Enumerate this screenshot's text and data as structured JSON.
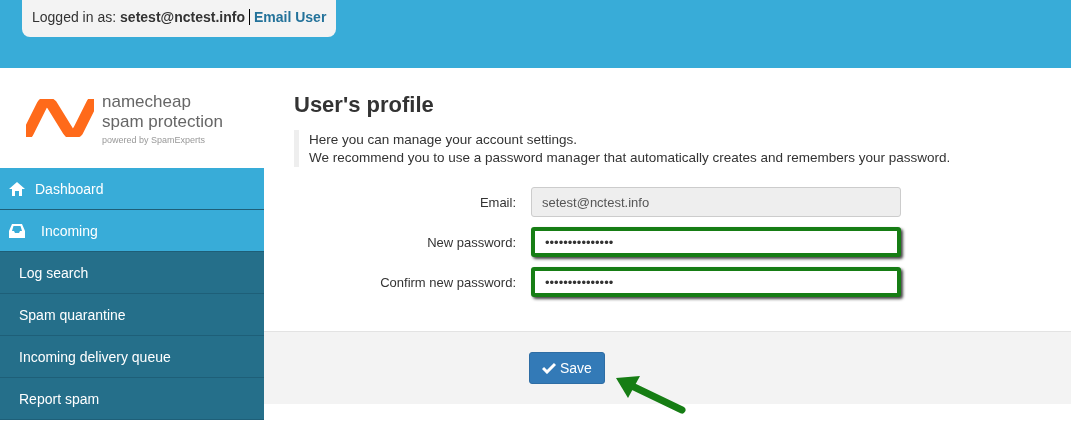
{
  "header": {
    "logged_in_label": "Logged in as:",
    "user": "setest@nctest.info",
    "link": "Email User"
  },
  "logo": {
    "name": "namecheap",
    "product": "spam protection",
    "powered_by": "powered by SpamExperts"
  },
  "sidebar": {
    "items": [
      {
        "label": "Dashboard",
        "kind": "section"
      },
      {
        "label": "Incoming",
        "kind": "section"
      },
      {
        "label": "Log search",
        "kind": "subitem"
      },
      {
        "label": "Spam quarantine",
        "kind": "subitem"
      },
      {
        "label": "Incoming delivery queue",
        "kind": "subitem"
      },
      {
        "label": "Report spam",
        "kind": "subitem"
      }
    ]
  },
  "page": {
    "title": "User's profile",
    "intro": [
      "Here you can manage your account settings.",
      "We recommend you to use a password manager that automatically creates and remembers your password."
    ]
  },
  "form": {
    "fields": [
      {
        "label": "Email:",
        "value": "setest@nctest.info",
        "disabled": true,
        "highlighted": false
      },
      {
        "label": "New password:",
        "value": "•••••••••••••••",
        "disabled": false,
        "highlighted": true
      },
      {
        "label": "Confirm new password:",
        "value": "•••••••••••••••",
        "disabled": false,
        "highlighted": true
      }
    ],
    "save": {
      "label": "Save",
      "highlighted": true
    }
  }
}
